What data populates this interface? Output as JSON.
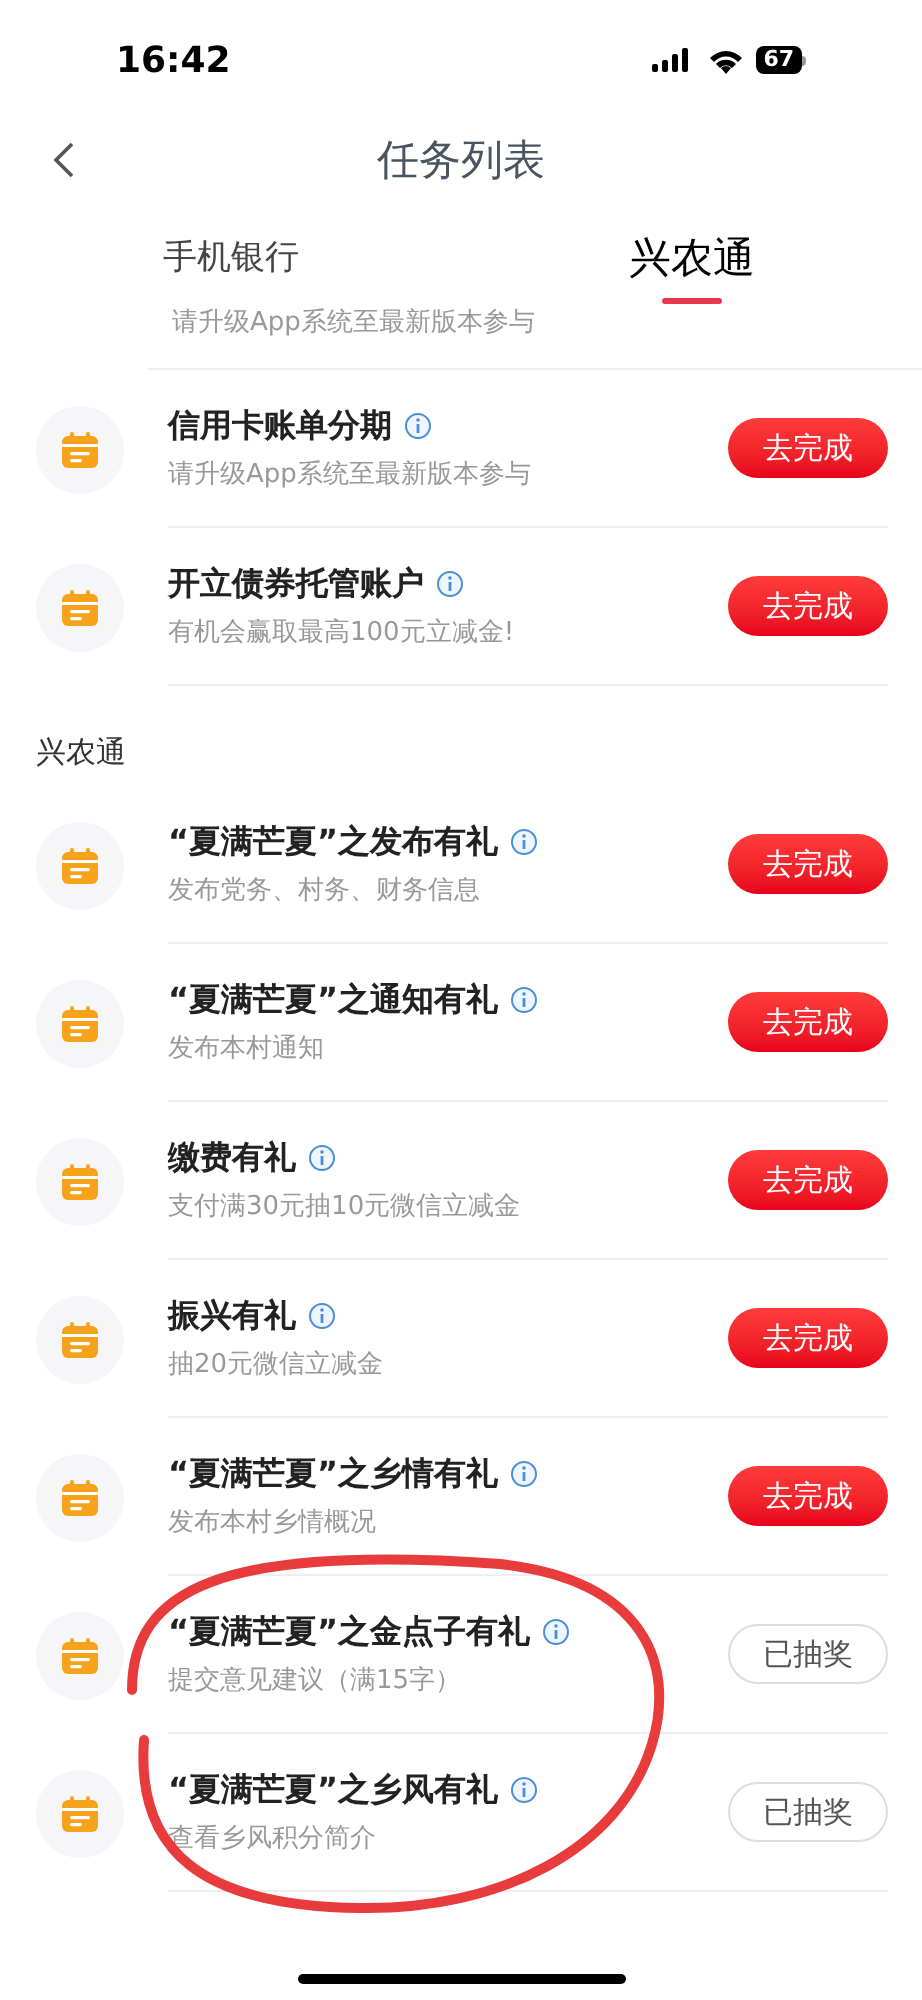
{
  "status_bar": {
    "time": "16:42",
    "battery": "67"
  },
  "nav": {
    "title": "任务列表"
  },
  "tabs": [
    {
      "label": "手机银行",
      "selected": false
    },
    {
      "label": "兴农通",
      "selected": true
    }
  ],
  "cut_row": {
    "subtitle": "请升级App系统至最新版本参与"
  },
  "sections": [
    {
      "tasks": [
        {
          "title": "信用卡账单分期",
          "subtitle": "请升级App系统至最新版本参与",
          "button": {
            "label": "去完成",
            "kind": "todo"
          }
        },
        {
          "title": "开立债券托管账户",
          "subtitle": "有机会赢取最高100元立减金!",
          "button": {
            "label": "去完成",
            "kind": "todo"
          }
        }
      ]
    },
    {
      "header": "兴农通",
      "tasks": [
        {
          "title": "“夏满芒夏”之发布有礼",
          "subtitle": "发布党务、村务、财务信息",
          "button": {
            "label": "去完成",
            "kind": "todo"
          }
        },
        {
          "title": "“夏满芒夏”之通知有礼",
          "subtitle": "发布本村通知",
          "button": {
            "label": "去完成",
            "kind": "todo"
          }
        },
        {
          "title": "缴费有礼",
          "subtitle": "支付满30元抽10元微信立减金",
          "button": {
            "label": "去完成",
            "kind": "todo"
          }
        },
        {
          "title": "振兴有礼",
          "subtitle": "抽20元微信立减金",
          "button": {
            "label": "去完成",
            "kind": "todo"
          }
        },
        {
          "title": "“夏满芒夏”之乡情有礼",
          "subtitle": "发布本村乡情概况",
          "button": {
            "label": "去完成",
            "kind": "todo"
          }
        },
        {
          "title": "“夏满芒夏”之金点子有礼",
          "subtitle": "提交意见建议（满15字）",
          "button": {
            "label": "已抽奖",
            "kind": "done"
          }
        },
        {
          "title": "“夏满芒夏”之乡风有礼",
          "subtitle": "查看乡风积分简介",
          "button": {
            "label": "已抽奖",
            "kind": "done"
          }
        }
      ]
    }
  ]
}
